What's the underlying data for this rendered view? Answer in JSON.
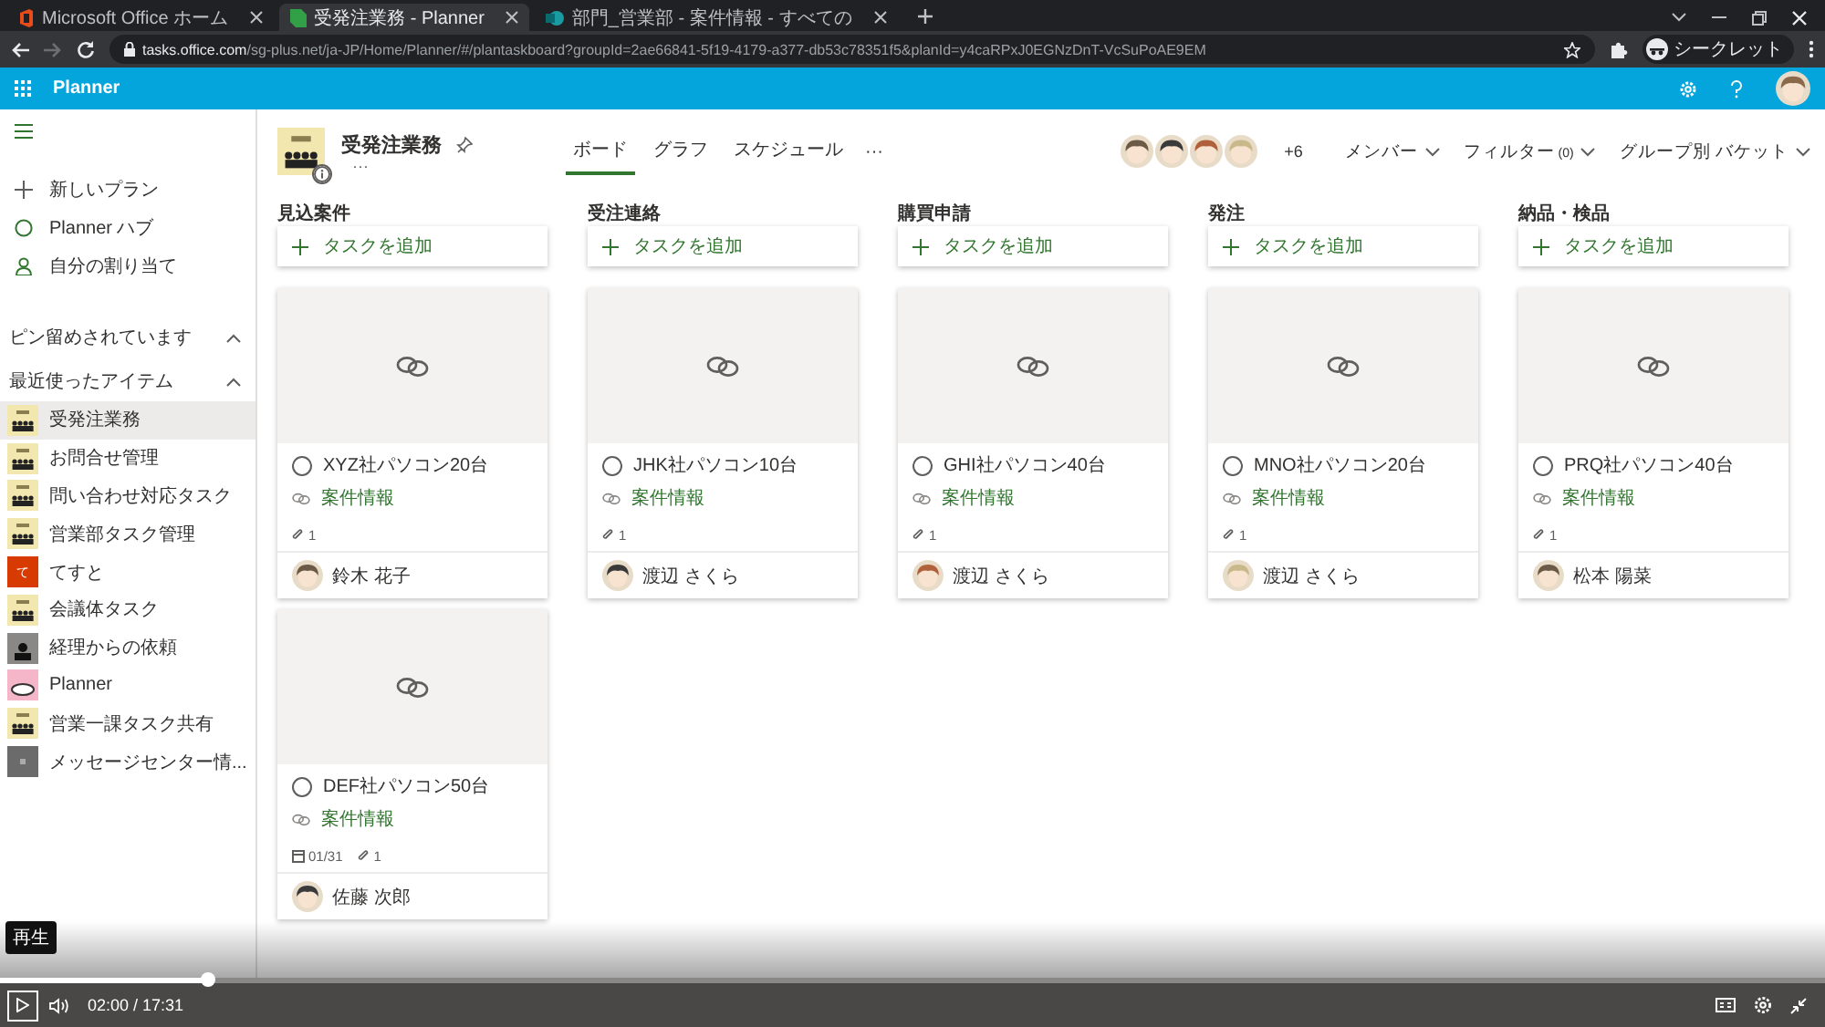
{
  "browser": {
    "tabs": [
      {
        "title": "Microsoft Office ホーム",
        "kind": "office",
        "selected": false
      },
      {
        "title": "受発注業務 - Planner",
        "kind": "planner",
        "selected": true
      },
      {
        "title": "部門_営業部 - 案件情報 - すべての",
        "kind": "sharepoint",
        "selected": false
      }
    ],
    "url_host": "tasks.office.com",
    "url_path": "/sg-plus.net/ja-JP/Home/Planner/#/plantaskboard?groupId=2ae66841-5f19-4179-a377-db53c78351f5&planId=y4caRPxJ0EGNzDnT-VcSuPoAE9EM",
    "profile_label": "シークレット"
  },
  "app_bar": {
    "title": "Planner"
  },
  "sidebar": {
    "nav": [
      {
        "label": "新しいプラン",
        "kind": "plus"
      },
      {
        "label": "Planner ハブ",
        "kind": "hub"
      },
      {
        "label": "自分の割り当て",
        "kind": "person"
      }
    ],
    "sections": [
      {
        "title": "ピン留めされています",
        "expanded": true
      },
      {
        "title": "最近使ったアイテム",
        "expanded": true
      }
    ],
    "recent": [
      {
        "name": "受発注業務",
        "kind": "group",
        "selected": true
      },
      {
        "name": "お問合せ管理",
        "kind": "group",
        "selected": false
      },
      {
        "name": "問い合わせ対応タスク",
        "kind": "group",
        "selected": false
      },
      {
        "name": "営業部タスク管理",
        "kind": "group",
        "selected": false
      },
      {
        "name": "てすと",
        "kind": "letter",
        "thumb_text": "て",
        "selected": false
      },
      {
        "name": "会議体タスク",
        "kind": "group",
        "selected": false
      },
      {
        "name": "経理からの依頼",
        "kind": "dark",
        "selected": false
      },
      {
        "name": "Planner",
        "kind": "pink",
        "selected": false
      },
      {
        "name": "営業一課タスク共有",
        "kind": "group",
        "selected": false
      },
      {
        "name": "メッセージセンター情...",
        "kind": "gray",
        "selected": false
      }
    ]
  },
  "plan": {
    "name": "受発注業務",
    "more": "···",
    "tabs": [
      {
        "label": "ボード",
        "selected": true
      },
      {
        "label": "グラフ",
        "selected": false
      },
      {
        "label": "スケジュール",
        "selected": false
      }
    ],
    "tabs_more": "···",
    "members": [
      {
        "kind": "avatar"
      },
      {
        "kind": "avatar"
      },
      {
        "kind": "avatar"
      },
      {
        "kind": "avatar"
      }
    ],
    "extra_members": "+6",
    "member_button": "メンバー",
    "filter_button": "フィルター",
    "filter_count": "(0)",
    "group_button": "グループ別 バケット"
  },
  "buckets": [
    {
      "name": "見込案件",
      "add_label": "タスクを追加",
      "tasks": [
        {
          "title": "XYZ社パソコン20台",
          "completed": false,
          "label": "案件情報",
          "attachments": "1",
          "assignee": "鈴木 花子"
        },
        {
          "title": "DEF社パソコン50台",
          "completed": false,
          "label": "案件情報",
          "due": "01/31",
          "attachments": "1",
          "assignee": "佐藤 次郎"
        }
      ]
    },
    {
      "name": "受注連絡",
      "add_label": "タスクを追加",
      "tasks": [
        {
          "title": "JHK社パソコン10台",
          "completed": false,
          "label": "案件情報",
          "attachments": "1",
          "assignee": "渡辺 さくら"
        }
      ]
    },
    {
      "name": "購買申請",
      "add_label": "タスクを追加",
      "tasks": [
        {
          "title": "GHI社パソコン40台",
          "completed": false,
          "label": "案件情報",
          "attachments": "1",
          "assignee": "渡辺 さくら"
        }
      ]
    },
    {
      "name": "発注",
      "add_label": "タスクを追加",
      "tasks": [
        {
          "title": "MNO社パソコン20台",
          "completed": false,
          "label": "案件情報",
          "attachments": "1",
          "assignee": "渡辺 さくら"
        }
      ]
    },
    {
      "name": "納品・検品",
      "add_label": "タスクを追加",
      "tasks": [
        {
          "title": "PRQ社パソコン40台",
          "completed": false,
          "label": "案件情報",
          "attachments": "1",
          "assignee": "松本 陽菜"
        }
      ]
    }
  ],
  "video": {
    "tooltip": "再生",
    "time": "02:00 / 17:31",
    "level": 0.114
  }
}
